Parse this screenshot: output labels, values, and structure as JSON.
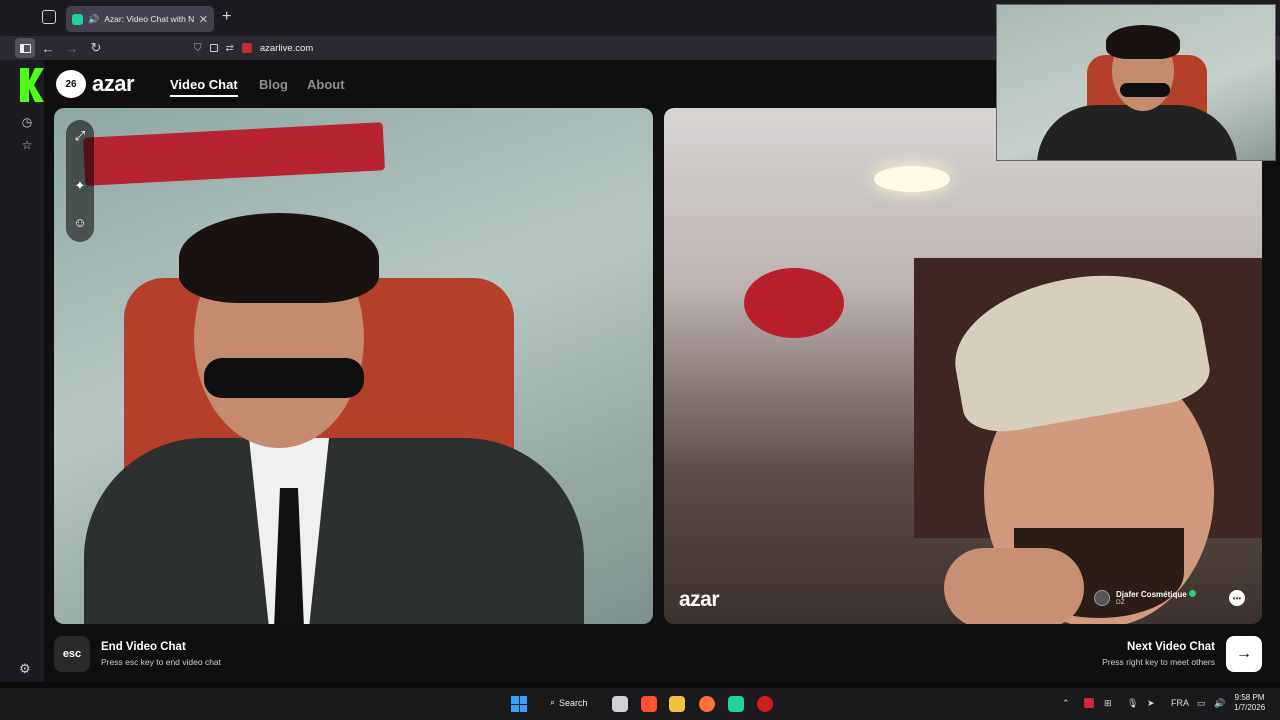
{
  "browser": {
    "tab_title": "Azar: Video Chat with New",
    "url": "azarlive.com",
    "new_tab_label": "+",
    "close_tab_label": "✕"
  },
  "site": {
    "logo_badge": "26",
    "logo_text": "azar",
    "nav": {
      "video_chat": "Video Chat",
      "blog": "Blog",
      "about": "About"
    }
  },
  "remote_user": {
    "watermark": "azar",
    "name": "Djafer Cosmétique",
    "country": "DZ"
  },
  "controls": {
    "esc_key": "esc",
    "end_title": "End Video Chat",
    "end_sub": "Press esc key to end video chat",
    "next_title": "Next Video Chat",
    "next_sub": "Press right key to meet others",
    "next_arrow": "→"
  },
  "taskbar": {
    "search_label": "Search",
    "language": "FRA",
    "time": "9:58 PM",
    "date": "1/7/2026"
  },
  "colors": {
    "kick_green": "#53fc18",
    "accent_teal": "#1fd1a0",
    "windows_blue": "#3aa0ff"
  }
}
